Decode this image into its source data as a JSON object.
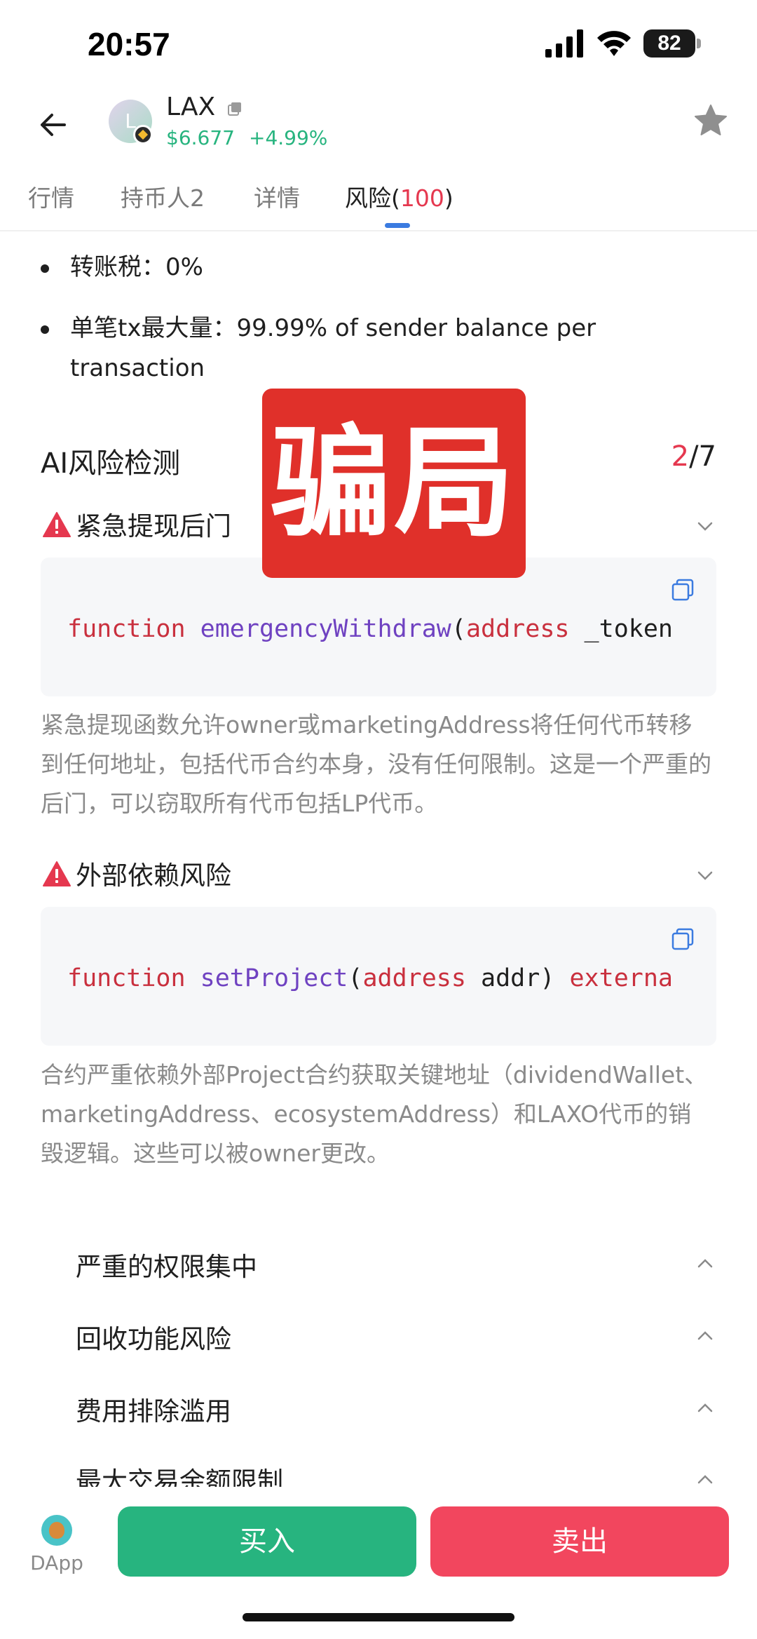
{
  "status_bar": {
    "time": "20:57",
    "battery": "82"
  },
  "header": {
    "token_name": "LAX",
    "avatar_letter": "L",
    "price": "$6.677",
    "change": "+4.99%"
  },
  "tabs": [
    {
      "label": "行情"
    },
    {
      "label": "持币人2"
    },
    {
      "label": "详情"
    },
    {
      "label": "风险(",
      "count": "100",
      "suffix": ")"
    }
  ],
  "tax_info": [
    {
      "label": "转账税：",
      "value": "0%"
    },
    {
      "label": "单笔tx最大量：",
      "value": "99.99% of sender balance per",
      "value_cont": "transaction"
    }
  ],
  "ai_section": {
    "title": "AI风险检测",
    "current": "2",
    "total": "/7"
  },
  "risks": [
    {
      "title": "紧急提现后门",
      "code": {
        "kw1": "function",
        "fn": "emergencyWithdraw",
        "paren": "(",
        "kw2": "address",
        "rest": " _token"
      },
      "desc": "紧急提现函数允许owner或marketingAddress将任何代币转移到任何地址，包括代币合约本身，没有任何限制。这是一个严重的后门，可以窃取所有代币包括LP代币。"
    },
    {
      "title": "外部依赖风险",
      "code": {
        "kw1": "function",
        "fn": "setProject",
        "paren": "(",
        "kw2": "address",
        "rest": " addr) ",
        "kw3": "externa"
      },
      "desc": "合约严重依赖外部Project合约获取关键地址（dividendWallet、marketingAddress、ecosystemAddress）和LAXO代币的销毁逻辑。这些可以被owner更改。"
    }
  ],
  "collapsed_risks": [
    "严重的权限集中",
    "回收功能风险",
    "费用排除滥用",
    "最大交易余额限制"
  ],
  "stamp_text": "骗局",
  "bottom_bar": {
    "dapp_label": "DApp",
    "buy_label": "买入",
    "sell_label": "卖出"
  },
  "colors": {
    "green": "#27b47f",
    "red": "#f2465e",
    "accent_blue": "#3b7be0",
    "risk_red": "#e5384f"
  }
}
